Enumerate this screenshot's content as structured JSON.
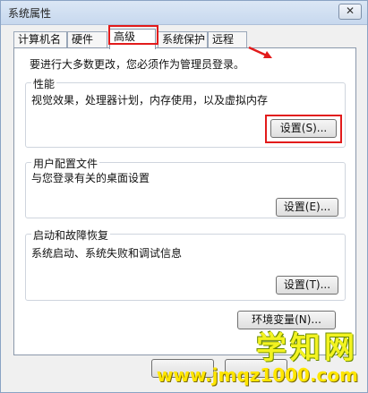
{
  "window": {
    "title": "系统属性",
    "close_label": "✕"
  },
  "tabs": [
    {
      "label": "计算机名",
      "active": false
    },
    {
      "label": "硬件",
      "active": false
    },
    {
      "label": "高级",
      "active": true
    },
    {
      "label": "系统保护",
      "active": false
    },
    {
      "label": "远程",
      "active": false
    }
  ],
  "notice": "要进行大多数更改，您必须作为管理员登录。",
  "performance": {
    "title": "性能",
    "description": "视觉效果，处理器计划，内存使用，以及虚拟内存",
    "button_label": "设置(S)..."
  },
  "user_profiles": {
    "title": "用户配置文件",
    "description": "与您登录有关的桌面设置",
    "button_label": "设置(E)..."
  },
  "startup_recovery": {
    "title": "启动和故障恢复",
    "description": "系统启动、系统失败和调试信息",
    "button_label": "设置(T)..."
  },
  "env_button_label": "环境变量(N)...",
  "watermark": {
    "text": "学知网",
    "url": "www.jmqz1000.com"
  },
  "accent_color": "#e21b1b"
}
